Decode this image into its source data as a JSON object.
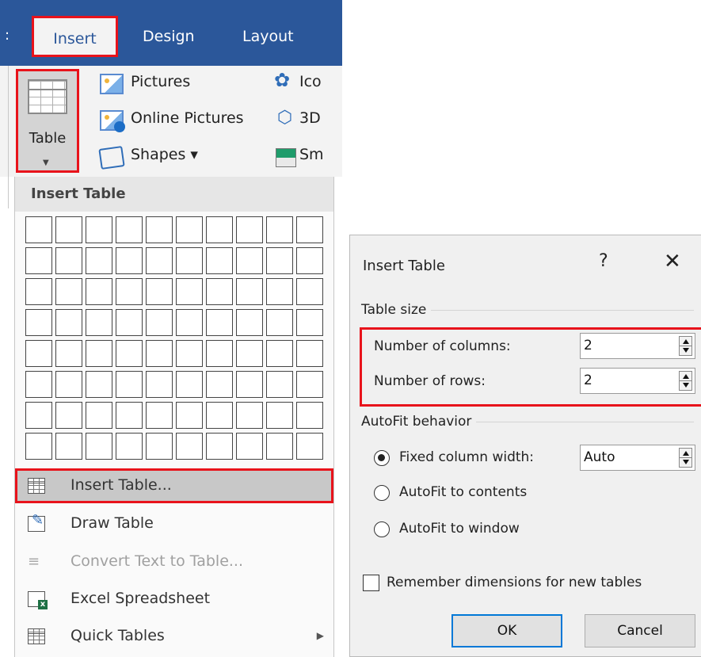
{
  "ribbon": {
    "tab_edge": ":",
    "tabs": [
      {
        "label": "Insert"
      },
      {
        "label": "Design"
      },
      {
        "label": "Layout"
      }
    ],
    "table_button_label": "Table",
    "items": {
      "pictures": "Pictures",
      "online_pictures": "Online Pictures",
      "shapes": "Shapes ▾",
      "icons": "Ico",
      "models_3d": "3D",
      "smartart": "Sm"
    }
  },
  "dropdown": {
    "header": "Insert Table",
    "grid": {
      "columns": 10,
      "rows": 8
    },
    "items": [
      {
        "label": "Insert Table...",
        "icon": "table-icon"
      },
      {
        "label": "Draw Table",
        "icon": "draw-table-icon"
      },
      {
        "label": "Convert Text to Table...",
        "icon": "convert-text-icon"
      },
      {
        "label": "Excel Spreadsheet",
        "icon": "excel-icon"
      },
      {
        "label": "Quick Tables",
        "icon": "quick-tables-icon",
        "submenu_arrow": "▶"
      }
    ]
  },
  "dialog": {
    "title": "Insert Table",
    "help": "?",
    "close": "✕",
    "table_size": {
      "heading": "Table size",
      "columns_label": "Number of columns:",
      "columns_value": "2",
      "rows_label": "Number of rows:",
      "rows_value": "2"
    },
    "autofit": {
      "heading": "AutoFit behavior",
      "options": [
        {
          "label": "Fixed column width:",
          "checked": true
        },
        {
          "label": "AutoFit to contents",
          "checked": false
        },
        {
          "label": "AutoFit to window",
          "checked": false
        }
      ],
      "width_value": "Auto"
    },
    "remember_label": "Remember dimensions for new tables",
    "remember_checked": false,
    "ok_label": "OK",
    "cancel_label": "Cancel"
  },
  "colors": {
    "ribbon_blue": "#2b579a",
    "highlight_red": "#e8131b",
    "default_button_border": "#0078d7"
  }
}
